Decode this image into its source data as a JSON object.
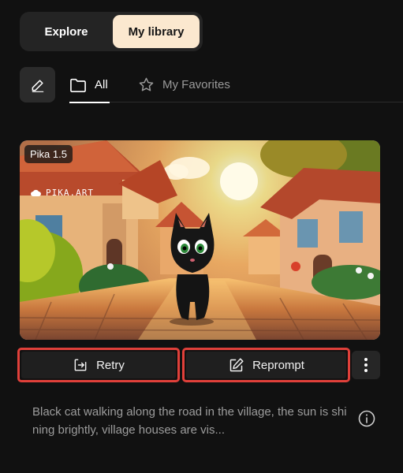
{
  "toggle": {
    "explore_label": "Explore",
    "library_label": "My library",
    "active": "library"
  },
  "tabs": [
    {
      "label": "All",
      "icon": "folder-icon",
      "active": true
    },
    {
      "label": "My Favorites",
      "icon": "star-icon",
      "active": false
    }
  ],
  "video": {
    "model": "Pika 1.5",
    "watermark": "PIKA.ART"
  },
  "actions": {
    "retry_label": "Retry",
    "reprompt_label": "Reprompt"
  },
  "prompt_text": "Black cat walking along the road in the village, the sun is shining brightly, village houses are vis...",
  "colors": {
    "highlight_border": "#e0403a",
    "toggle_active_bg": "#fbe8cf",
    "background": "#111111"
  }
}
